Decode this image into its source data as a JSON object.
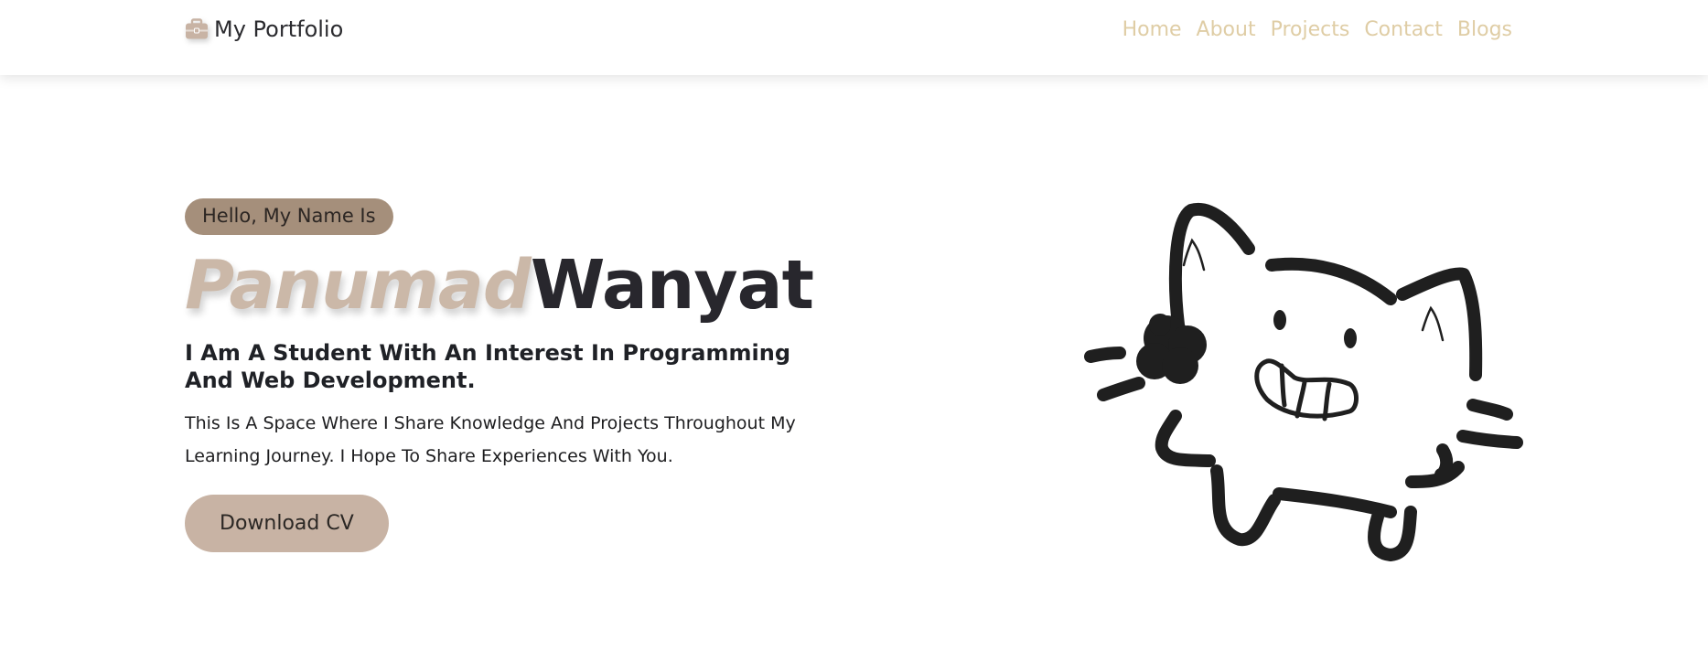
{
  "navbar": {
    "brand_label": "My Portfolio",
    "brand_icon": "briefcase-icon",
    "links": [
      {
        "label": "Home"
      },
      {
        "label": "About"
      },
      {
        "label": "Projects"
      },
      {
        "label": "Contact"
      },
      {
        "label": "Blogs"
      }
    ]
  },
  "hero": {
    "greeting": "Hello, My Name Is",
    "first_name": "Panumad",
    "last_name": "Wanyat",
    "tagline": "I Am A Student With An Interest In Programming And Web Development.",
    "description": "This Is A Space Where I Share Knowledge And Projects Throughout My Learning Journey. I Hope To Share Experiences With You.",
    "cv_button": "Download CV"
  },
  "illustration": {
    "icon": "cat-doodle-icon"
  },
  "colors": {
    "nav_link": "#dfcda5",
    "greeting_pill": "#a58f7b",
    "first_name": "#cbb8a8",
    "last_name": "#28272d",
    "cv_button": "#c8b3a4",
    "brand_icon": "#c8b3a4"
  }
}
